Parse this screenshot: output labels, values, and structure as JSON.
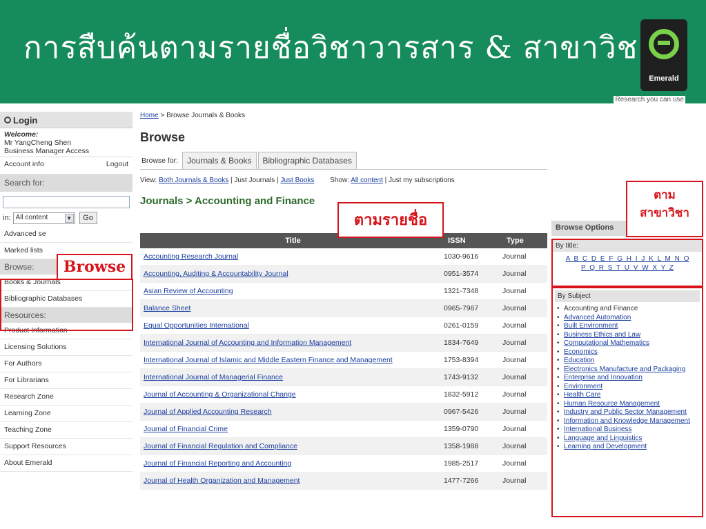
{
  "slide": {
    "title": "การสืบค้นตามรายชื่อวิชาวารสาร & สาขาวิชา",
    "logo_text": "Emerald",
    "tagline": "Research you can use",
    "brand_color": "#168b5b",
    "highlight_color": "#d7141c"
  },
  "sidebar": {
    "login_label": "Login",
    "welcome_label": "Welcome:",
    "user_name": "Mr YangCheng Shen",
    "user_role": "Business Manager Access",
    "account_info": "Account info",
    "logout": "Logout",
    "search_label": "Search for:",
    "in_label": "in:",
    "scope_selected": "All content",
    "go_label": "Go",
    "advanced_search": "Advanced se",
    "marked_lists": "Marked lists",
    "browse_head": "Browse:",
    "browse_items": [
      "Books & Journals",
      "Bibliographic Databases"
    ],
    "resources_head": "Resources:",
    "resource_items": [
      "Product Information",
      "Licensing Solutions",
      "For Authors",
      "For Librarians",
      "Research Zone",
      "Learning Zone",
      "Teaching Zone",
      "Support Resources",
      "About Emerald"
    ]
  },
  "main": {
    "breadcrumb_home": "Home",
    "breadcrumb_rest": " > Browse Journals & Books",
    "title": "Browse",
    "browse_for_label": "Browse for:",
    "tabs": [
      "Journals & Books",
      "Bibliographic Databases"
    ],
    "view_label": "View:",
    "view_both": "Both Journals & Books",
    "view_journals": " | Just Journals | ",
    "view_books": "Just Books",
    "show_label": "Show:",
    "show_all": "All content",
    "show_mine": " | Just my subscriptions",
    "section_title": "Journals > Accounting and Finance",
    "columns": [
      "Title",
      "ISSN",
      "Type"
    ],
    "rows": [
      {
        "title": "Accounting Research Journal",
        "issn": "1030-9616",
        "type": "Journal"
      },
      {
        "title": "Accounting, Auditing & Accountability Journal",
        "issn": "0951-3574",
        "type": "Journal"
      },
      {
        "title": "Asian Review of Accounting",
        "issn": "1321-7348",
        "type": "Journal"
      },
      {
        "title": "Balance Sheet",
        "issn": "0965-7967",
        "type": "Journal"
      },
      {
        "title": "Equal Opportunities International",
        "issn": "0261-0159",
        "type": "Journal"
      },
      {
        "title": "International Journal of Accounting and Information Management",
        "issn": "1834-7649",
        "type": "Journal"
      },
      {
        "title": "International Journal of Islamic and Middle Eastern Finance and Management",
        "issn": "1753-8394",
        "type": "Journal"
      },
      {
        "title": "International Journal of Managerial Finance",
        "issn": "1743-9132",
        "type": "Journal"
      },
      {
        "title": "Journal of Accounting & Organizational Change",
        "issn": "1832-5912",
        "type": "Journal"
      },
      {
        "title": "Journal of Applied Accounting Research",
        "issn": "0967-5426",
        "type": "Journal"
      },
      {
        "title": "Journal of Financial Crime",
        "issn": "1359-0790",
        "type": "Journal"
      },
      {
        "title": "Journal of Financial Regulation and Compliance",
        "issn": "1358-1988",
        "type": "Journal"
      },
      {
        "title": "Journal of Financial Reporting and Accounting",
        "issn": "1985-2517",
        "type": "Journal"
      },
      {
        "title": "Journal of Health Organization and Management",
        "issn": "1477-7266",
        "type": "Journal"
      }
    ]
  },
  "right": {
    "options_head": "Browse Options",
    "by_title": "By title:",
    "letters_line1": "A B C D E F G H I J K L M N O",
    "letters_line2": "P Q R S T U V W X Y Z",
    "by_subject": "By Subject",
    "subjects": [
      "Accounting and Finance",
      "Advanced Automation",
      "Built Environment",
      "Business Ethics and Law",
      "Computational Mathematics",
      "Economics",
      "Education",
      "Electronics Manufacture and Packaging",
      "Enterprise and Innovation",
      "Environment",
      "Health Care",
      "Human Resource Management",
      "Industry and Public Sector Management",
      "Information and Knowledge Management",
      "International Business",
      "Language and Linguistics",
      "Learning and Development"
    ]
  },
  "callouts": {
    "browse": "Browse",
    "by_name": "ตามรายชื่อ",
    "by_subject_line1": "ตาม",
    "by_subject_line2": "สาขาวิชา"
  }
}
